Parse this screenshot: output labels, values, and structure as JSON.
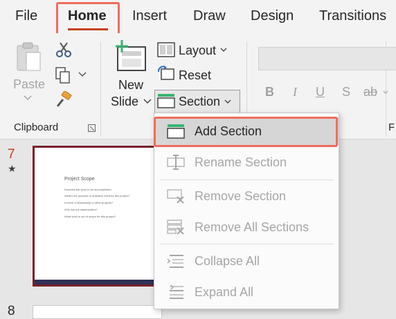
{
  "menu_tabs": [
    "File",
    "Home",
    "Insert",
    "Draw",
    "Design",
    "Transitions"
  ],
  "active_tab": "Home",
  "colors": {
    "accent": "#c43e1c",
    "highlight": "#ef6c5a",
    "thumb_border": "#7a1f2b",
    "section_green": "#3cb371"
  },
  "clipboard": {
    "paste_label": "Paste",
    "group_label": "Clipboard"
  },
  "slides": {
    "new_slide_label_1": "New",
    "new_slide_label_2": "Slide",
    "layout_label": "Layout",
    "reset_label": "Reset",
    "section_label": "Section"
  },
  "font": {
    "bold": "B",
    "italic": "I",
    "underline": "U",
    "shadow": "S",
    "strike": "ab",
    "group_fragment": "F"
  },
  "section_menu": {
    "items": [
      {
        "label": "Add Section",
        "enabled": true
      },
      {
        "label": "Rename Section",
        "enabled": false
      },
      {
        "label": "Remove Section",
        "enabled": false
      },
      {
        "label": "Remove All Sections",
        "enabled": false
      },
      {
        "label": "Collapse All",
        "enabled": false
      },
      {
        "label": "Expand All",
        "enabled": false
      }
    ]
  },
  "thumbnails": [
    {
      "number": "7",
      "title": "Project Scope",
      "bullets": [
        "Describe the work to be accomplished",
        "What's the purpose or business need for this project?",
        "Is there a relationship to other projects?",
        "Who are the stakeholders?",
        "What work is out of scope for this project?"
      ]
    },
    {
      "number": "8"
    }
  ]
}
